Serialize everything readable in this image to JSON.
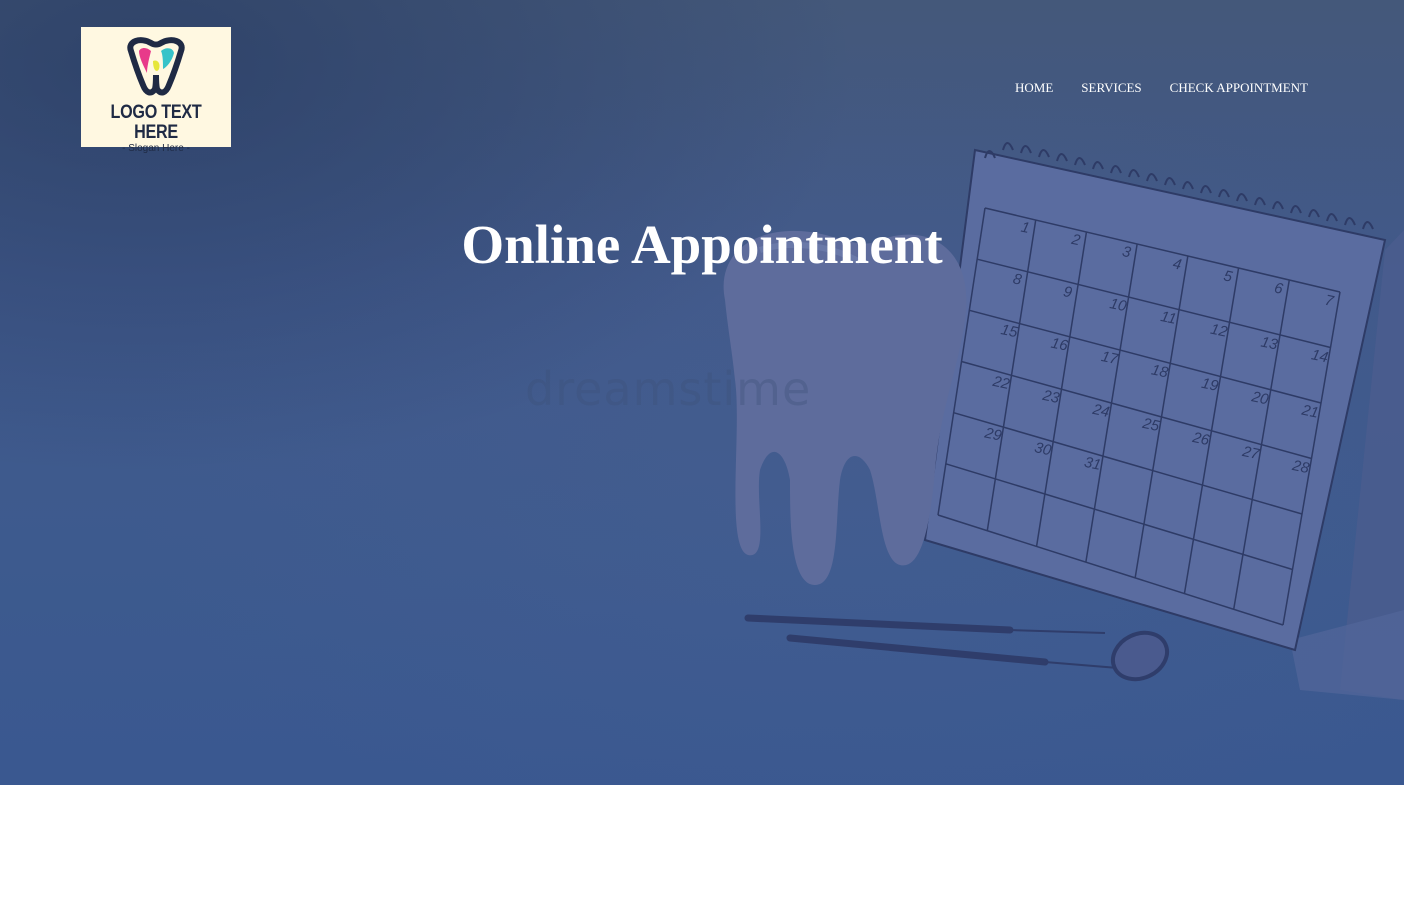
{
  "logo": {
    "title": "LOGO TEXT HERE",
    "slogan": "- Slogan Here -",
    "icon": "tooth-logo-icon"
  },
  "nav": {
    "items": [
      {
        "label": "HOME"
      },
      {
        "label": "SERVICES"
      },
      {
        "label": "CHECK APPOINTMENT"
      }
    ]
  },
  "hero": {
    "title": "Online Appointment",
    "watermark": "dreamstime",
    "calendar_days": [
      "1",
      "2",
      "3",
      "4",
      "5",
      "6",
      "7",
      "8",
      "9",
      "10",
      "11",
      "12",
      "13",
      "14",
      "15",
      "16",
      "17",
      "18",
      "19",
      "20",
      "21",
      "22",
      "23",
      "24",
      "25",
      "26",
      "27",
      "28",
      "29",
      "30",
      "31"
    ]
  },
  "colors": {
    "hero_overlay": "#41598a",
    "logo_bg": "#fff8e1",
    "nav_text": "#ffffff"
  }
}
